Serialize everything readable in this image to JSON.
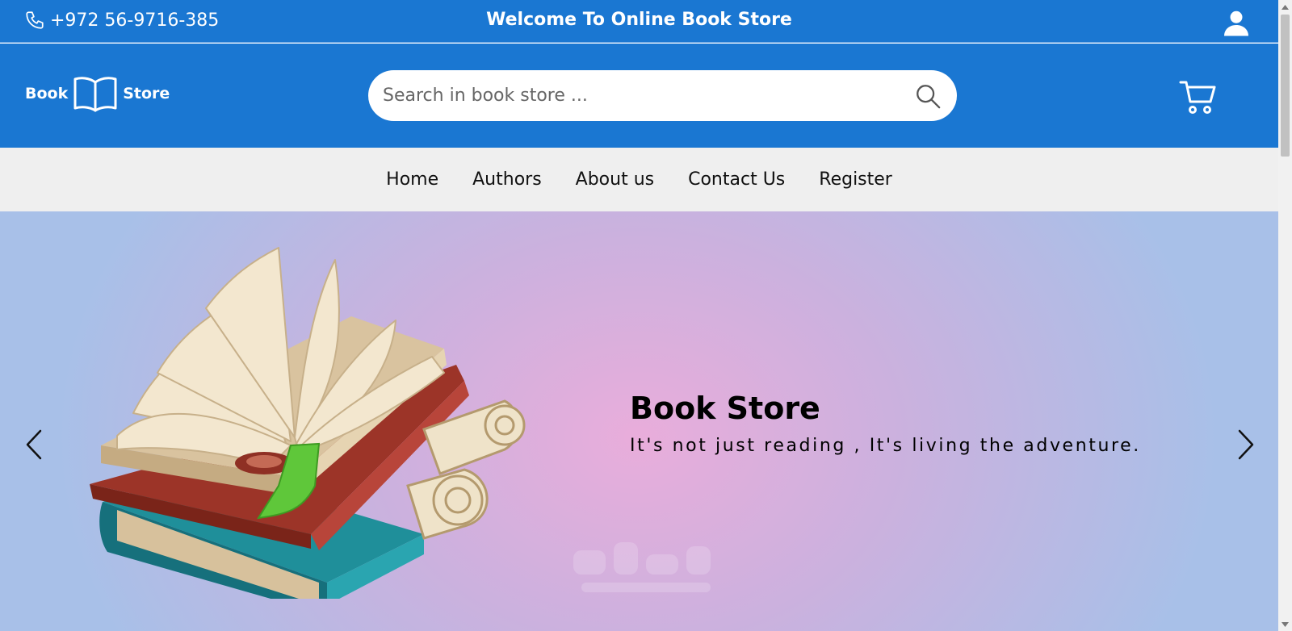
{
  "topbar": {
    "phone": "+972 56-9716-385",
    "welcome": "Welcome To Online Book Store",
    "user_icon": "user-icon"
  },
  "header": {
    "logo_left": "Book",
    "logo_right": "Store",
    "logo_icon": "open-book-icon",
    "search_placeholder": "Search in book store ...",
    "search_icon": "search-icon",
    "cart_icon": "cart-icon"
  },
  "nav": {
    "items": [
      {
        "label": "Home"
      },
      {
        "label": "Authors"
      },
      {
        "label": "About us"
      },
      {
        "label": "Contact Us"
      },
      {
        "label": "Register"
      }
    ]
  },
  "hero": {
    "title": "Book Store",
    "subtitle": "It's not just reading , It's living the adventure.",
    "prev_icon": "chevron-left-icon",
    "next_icon": "chevron-right-icon"
  },
  "colors": {
    "brand_blue": "#1a77d2",
    "nav_bg": "#efefef"
  }
}
